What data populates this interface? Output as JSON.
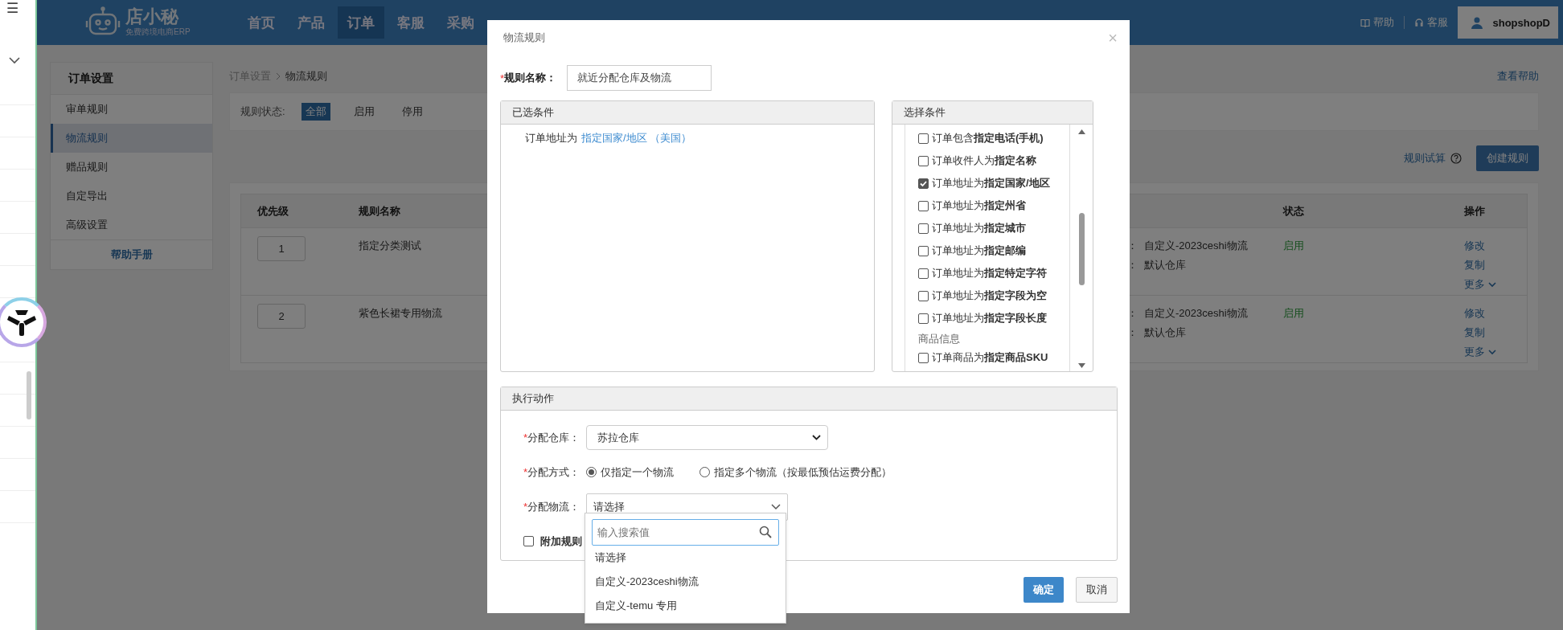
{
  "left_strip": {
    "menu_glyph": "☰"
  },
  "topbar": {
    "logo": {
      "name": "店小秘",
      "tagline": "免费跨境电商ERP"
    },
    "nav": [
      {
        "label": "首页",
        "selected": false
      },
      {
        "label": "产品",
        "selected": false
      },
      {
        "label": "订单",
        "selected": true
      },
      {
        "label": "客服",
        "selected": false
      },
      {
        "label": "采购",
        "selected": false
      }
    ],
    "help": "帮助",
    "service": "客服",
    "user": "shopshopD"
  },
  "sidebar": {
    "title": "订单设置",
    "items": [
      {
        "label": "审单规则",
        "selected": false
      },
      {
        "label": "物流规则",
        "selected": true
      },
      {
        "label": "赠品规则",
        "selected": false
      },
      {
        "label": "自定导出",
        "selected": false
      },
      {
        "label": "高级设置",
        "selected": false
      }
    ],
    "footer": "帮助手册"
  },
  "breadcrumb": [
    "订单设置",
    "物流规则"
  ],
  "view_help": "查看帮助",
  "status_filter": {
    "label": "规则状态:",
    "options": [
      {
        "label": "全部",
        "selected": true
      },
      {
        "label": "启用",
        "selected": false
      },
      {
        "label": "停用",
        "selected": false
      }
    ]
  },
  "rule_test": "规则试算",
  "create_button": "创建规则",
  "table": {
    "columns": [
      "优先级",
      "规则名称",
      "状态",
      "操作"
    ],
    "rows": [
      {
        "priority": "1",
        "name": "指定分类测试",
        "details": [
          {
            "label": "：",
            "value": "自定义-2023ceshi物流"
          },
          {
            "label": "：",
            "value": "默认仓库"
          }
        ],
        "status": "启用",
        "actions": [
          "修改",
          "复制",
          "更多"
        ]
      },
      {
        "priority": "2",
        "name": "紫色长裙专用物流",
        "details": [
          {
            "label": "：",
            "value": "自定义-2023ceshi物流"
          },
          {
            "label": "：",
            "value": "默认仓库"
          }
        ],
        "status": "启用",
        "actions": [
          "修改",
          "复制",
          "更多"
        ]
      }
    ]
  },
  "dialog": {
    "title": "物流规则",
    "close": "×",
    "rule_name": {
      "required_mark": "*",
      "label": "规则名称：",
      "value": "就近分配仓库及物流"
    },
    "selected_panel": {
      "title": "已选条件",
      "conditions": [
        {
          "text": "订单地址为",
          "link": "指定国家/地区 （美国）"
        }
      ]
    },
    "choose_panel": {
      "title": "选择条件",
      "items": [
        {
          "kind": "option",
          "text": "订单包含**指定电话(手机)**",
          "checked": false
        },
        {
          "kind": "option",
          "text": "订单收件人为**指定名称**",
          "checked": false
        },
        {
          "kind": "option",
          "text": "订单地址为**指定国家/地区**",
          "checked": true
        },
        {
          "kind": "option",
          "text": "订单地址为**指定州省**",
          "checked": false
        },
        {
          "kind": "option",
          "text": "订单地址为**指定城市**",
          "checked": false
        },
        {
          "kind": "option",
          "text": "订单地址为**指定邮编**",
          "checked": false
        },
        {
          "kind": "option",
          "text": "订单地址为**指定特定字符**",
          "checked": false
        },
        {
          "kind": "option",
          "text": "订单地址为**指定字段为空**",
          "checked": false
        },
        {
          "kind": "option",
          "text": "订单地址为**指定字段长度**",
          "checked": false
        },
        {
          "kind": "group",
          "text": "商品信息"
        },
        {
          "kind": "option",
          "text": "订单商品为**指定商品SKU**",
          "checked": false
        }
      ]
    },
    "action_panel": {
      "title": "执行动作",
      "warehouse": {
        "required_mark": "*",
        "label": "分配仓库：",
        "value": "苏拉仓库"
      },
      "mode": {
        "required_mark": "*",
        "label": "分配方式：",
        "options": [
          {
            "label": "仅指定一个物流",
            "selected": true
          },
          {
            "label": "指定多个物流（按最低预估运费分配）",
            "selected": false
          }
        ]
      },
      "logistics": {
        "required_mark": "*",
        "label": "分配物流：",
        "value": "请选择",
        "expanded": true,
        "search_placeholder": "输入搜索值",
        "options": [
          "请选择",
          "自定义-2023ceshi物流",
          "自定义-temu 专用"
        ]
      },
      "extra_rule": {
        "label": "附加规则",
        "checked": false
      }
    },
    "buttons": [
      {
        "label": "确定",
        "kind": "primary"
      },
      {
        "label": "取消",
        "kind": "default"
      }
    ]
  }
}
